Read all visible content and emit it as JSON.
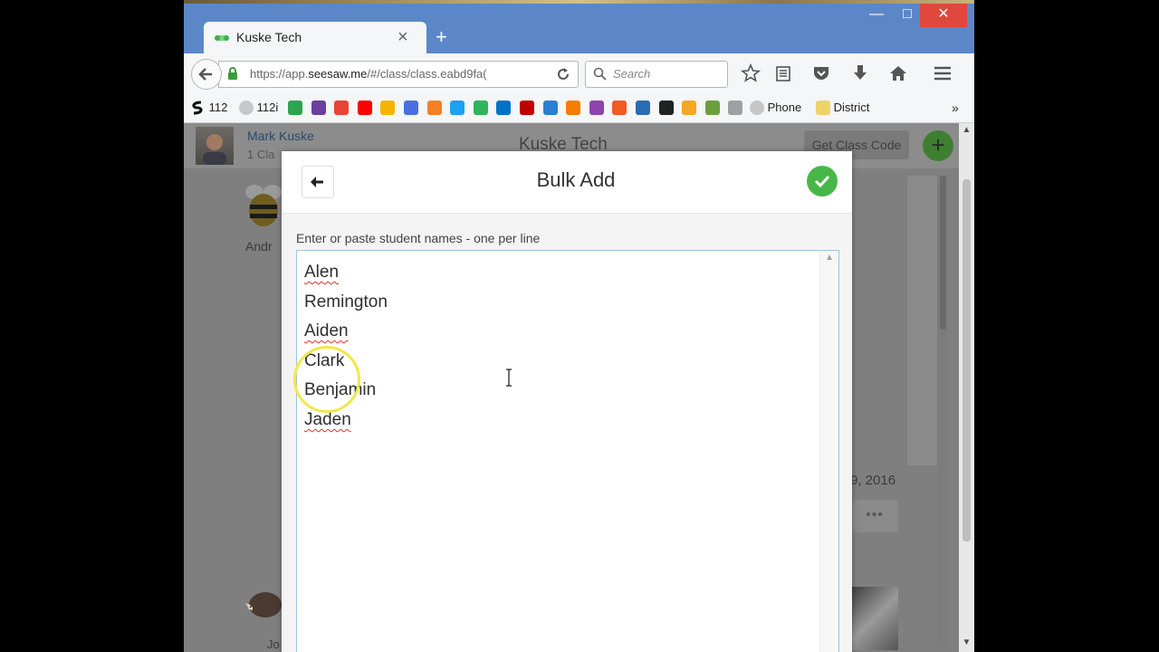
{
  "browser": {
    "tab_title": "Kuske Tech",
    "new_tab_symbol": "+",
    "url_prefix": "https://app.",
    "url_domain": "seesaw.me",
    "url_path": "/#/class/class.eabd9fa(",
    "search_placeholder": "Search",
    "window_controls": {
      "minimize": "—",
      "maximize": "□",
      "close": "✕"
    }
  },
  "bookmarks": [
    {
      "label": "112",
      "color": "#111111"
    },
    {
      "label": "112i",
      "color": "#b8b8b8"
    },
    {
      "label": "Phone",
      "color": "#c0c0c0"
    },
    {
      "label": "District",
      "color": "#f0d26a"
    }
  ],
  "bookmark_icon_colors": [
    "#2ea44f",
    "#6b3fa0",
    "#ea4335",
    "#ff0000",
    "#f4b400",
    "#4a6fe0",
    "#f48024",
    "#1da1f2",
    "#2fb55a",
    "#0072c6",
    "#c00000",
    "#2b7fd1",
    "#f57d00",
    "#8e44ad",
    "#f15a24",
    "#2b6cb0",
    "#222222",
    "#f5a623",
    "#6a9f3c",
    "#a0a0a0"
  ],
  "page": {
    "user_name": "Mark Kuske",
    "user_classes": "1 Cla",
    "class_title": "Kuske Tech",
    "get_code_label": "Get Class Code",
    "add_symbol": "+",
    "student1_partial": "Andr",
    "student2_partial": "Jo",
    "date_partial": "9, 2016",
    "more_label": "•••"
  },
  "modal": {
    "title": "Bulk Add",
    "instruction": "Enter or paste student names - one per line",
    "names": [
      {
        "text": "Alen",
        "spell_error": true
      },
      {
        "text": "Remington",
        "spell_error": false
      },
      {
        "text": "Aiden",
        "spell_error": true
      },
      {
        "text": "Clark",
        "spell_error": false
      },
      {
        "text": "Benjamin",
        "spell_error": false
      },
      {
        "text": "Jaden",
        "spell_error": true
      }
    ]
  },
  "colors": {
    "accent_green": "#48b749",
    "titlebar_blue": "#5b87c8",
    "close_red": "#e0473d"
  }
}
